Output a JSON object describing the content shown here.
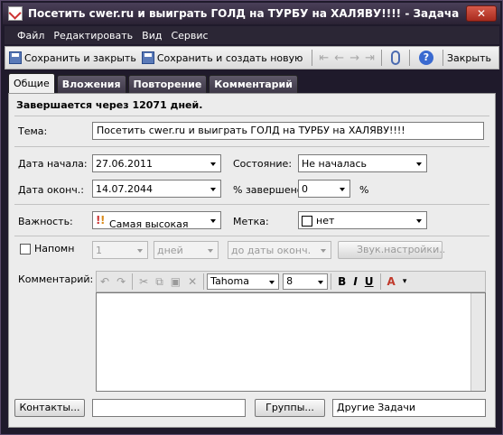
{
  "window": {
    "title": "Посетить cwer.ru и выиграть ГОЛД на ТУРБУ на ХАЛЯВУ!!!! - Задача",
    "close_glyph": "✕"
  },
  "menu": [
    "Файл",
    "Редактировать",
    "Вид",
    "Сервис"
  ],
  "toolbar": {
    "save_close": "Сохранить и закрыть",
    "save_new": "Сохранить и создать новую",
    "close": "Закрыть",
    "nav_glyphs": [
      "⇤",
      "←",
      "→",
      "⇥"
    ]
  },
  "tabs": [
    "Общие",
    "Вложения",
    "Повторение",
    "Комментарий"
  ],
  "form": {
    "due_text": "Завершается через 12071 дней.",
    "subject_label": "Тема:",
    "subject_value": "Посетить cwer.ru и выиграть ГОЛД на ТУРБУ на ХАЛЯВУ!!!!",
    "start_label": "Дата начала:",
    "start_value": "27.06.2011",
    "end_label": "Дата оконч.:",
    "end_value": "14.07.2044",
    "status_label": "Состояние:",
    "status_value": "Не началась",
    "percent_label": "% завершено:",
    "percent_value": "0",
    "percent_sign": "%",
    "priority_label": "Важность:",
    "priority_value": "Самая высокая",
    "label_label": "Метка:",
    "label_value": "нет",
    "remind_label": "Напомн",
    "remind_count": "1",
    "remind_unit": "дней",
    "remind_rel": "до даты оконч.",
    "sound_button": "Звук.настройки..",
    "comment_label": "Комментарий:",
    "font_name": "Tahoma",
    "font_size": "8",
    "contacts_button": "Контакты...",
    "contacts_value": "",
    "groups_button": "Группы...",
    "groups_value": "Другие Задачи"
  },
  "colors": {
    "chrome": "#2b2635",
    "panel": "#ececec",
    "tab_inactive": "#4e4858"
  }
}
